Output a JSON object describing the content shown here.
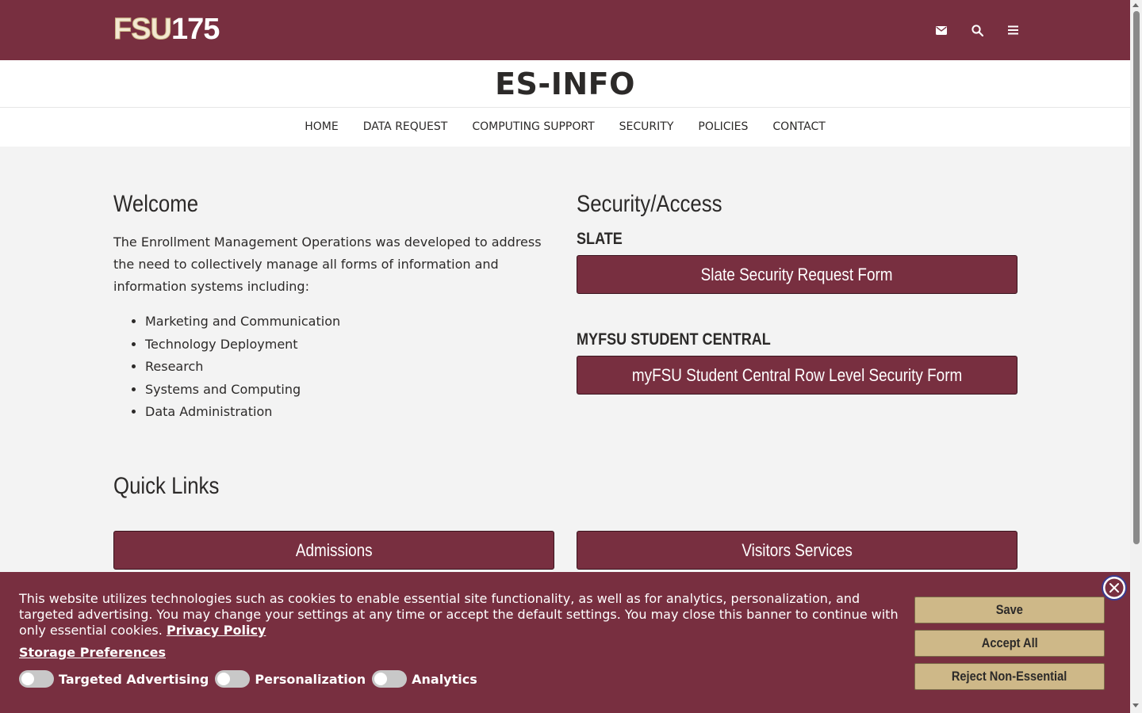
{
  "header": {
    "logo_fsu": "FSU",
    "logo_num": "175",
    "brand_color": "#782f40",
    "gold_color": "#ceb888",
    "icons": [
      "envelope-icon",
      "search-icon",
      "menu-icon"
    ]
  },
  "site_title": "ES-INFO",
  "nav": {
    "items": [
      "HOME",
      "DATA REQUEST",
      "COMPUTING SUPPORT",
      "SECURITY",
      "POLICIES",
      "CONTACT"
    ]
  },
  "welcome": {
    "title": "Welcome",
    "intro": "The Enrollment Management Operations was developed to address the need to collectively manage all forms of information and information systems including:",
    "bullets": [
      "Marketing and Communication",
      "Technology Deployment",
      "Research",
      "Systems and Computing",
      "Data Administration"
    ]
  },
  "security": {
    "title": "Security/Access",
    "slate_heading": "SLATE",
    "slate_button": "Slate Security Request Form",
    "myfsu_heading": "MYFSU STUDENT CENTRAL",
    "myfsu_button": "myFSU Student Central Row Level Security Form"
  },
  "quick_links": {
    "title": "Quick Links",
    "items": [
      "Admissions",
      "Visitors Services"
    ]
  },
  "cookie_banner": {
    "text": "This website utilizes technologies such as cookies to enable essential site functionality, as well as for analytics, personalization, and targeted advertising. You may change your settings at any time or accept the default settings. You may close this banner to continue with only essential cookies.",
    "privacy_link": "Privacy Policy",
    "storage_preferences": "Storage Preferences",
    "toggles": [
      "Targeted Advertising",
      "Personalization",
      "Analytics"
    ],
    "buttons": {
      "save": "Save",
      "accept_all": "Accept All",
      "reject": "Reject Non-Essential"
    }
  }
}
